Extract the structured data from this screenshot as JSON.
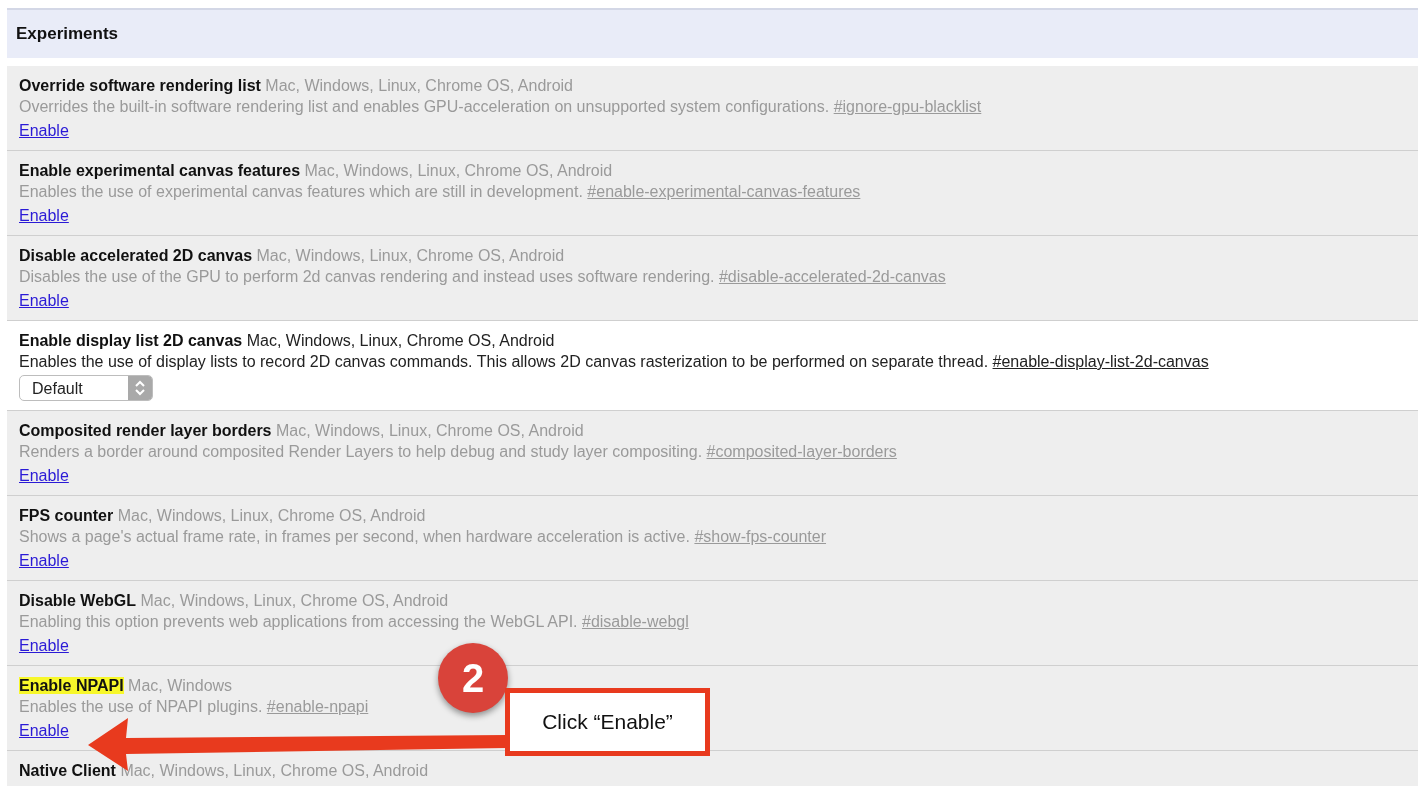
{
  "section": {
    "title": "Experiments"
  },
  "experiments": [
    {
      "name": "Override software rendering list",
      "platforms": "Mac, Windows, Linux, Chrome OS, Android",
      "description": "Overrides the built-in software rendering list and enables GPU-acceleration on unsupported system configurations.",
      "hashtag": "#ignore-gpu-blacklist",
      "kind": "link",
      "control": "Enable",
      "enabled": false,
      "highlighted": false
    },
    {
      "name": "Enable experimental canvas features",
      "platforms": "Mac, Windows, Linux, Chrome OS, Android",
      "description": "Enables the use of experimental canvas features which are still in development.",
      "hashtag": "#enable-experimental-canvas-features",
      "kind": "link",
      "control": "Enable",
      "enabled": false,
      "highlighted": false
    },
    {
      "name": "Disable accelerated 2D canvas",
      "platforms": "Mac, Windows, Linux, Chrome OS, Android",
      "description": "Disables the use of the GPU to perform 2d canvas rendering and instead uses software rendering.",
      "hashtag": "#disable-accelerated-2d-canvas",
      "kind": "link",
      "control": "Enable",
      "enabled": false,
      "highlighted": false
    },
    {
      "name": "Enable display list 2D canvas",
      "platforms": "Mac, Windows, Linux, Chrome OS, Android",
      "description": "Enables the use of display lists to record 2D canvas commands. This allows 2D canvas rasterization to be performed on separate thread.",
      "hashtag": "#enable-display-list-2d-canvas",
      "kind": "select",
      "control": "Default",
      "enabled": true,
      "highlighted": false
    },
    {
      "name": "Composited render layer borders",
      "platforms": "Mac, Windows, Linux, Chrome OS, Android",
      "description": "Renders a border around composited Render Layers to help debug and study layer compositing.",
      "hashtag": "#composited-layer-borders",
      "kind": "link",
      "control": "Enable",
      "enabled": false,
      "highlighted": false
    },
    {
      "name": "FPS counter",
      "platforms": "Mac, Windows, Linux, Chrome OS, Android",
      "description": "Shows a page's actual frame rate, in frames per second, when hardware acceleration is active.",
      "hashtag": "#show-fps-counter",
      "kind": "link",
      "control": "Enable",
      "enabled": false,
      "highlighted": false
    },
    {
      "name": "Disable WebGL",
      "platforms": "Mac, Windows, Linux, Chrome OS, Android",
      "description": "Enabling this option prevents web applications from accessing the WebGL API.",
      "hashtag": "#disable-webgl",
      "kind": "link",
      "control": "Enable",
      "enabled": false,
      "highlighted": false
    },
    {
      "name": "Enable NPAPI",
      "platforms": "Mac, Windows",
      "description": "Enables the use of NPAPI plugins.",
      "hashtag": "#enable-npapi",
      "kind": "link",
      "control": "Enable",
      "enabled": false,
      "highlighted": true
    },
    {
      "name": "Native Client",
      "platforms": "Mac, Windows, Linux, Chrome OS, Android",
      "enabled": false,
      "highlighted": false
    }
  ],
  "annotation": {
    "step": "2",
    "callout": "Click “Enable”"
  }
}
